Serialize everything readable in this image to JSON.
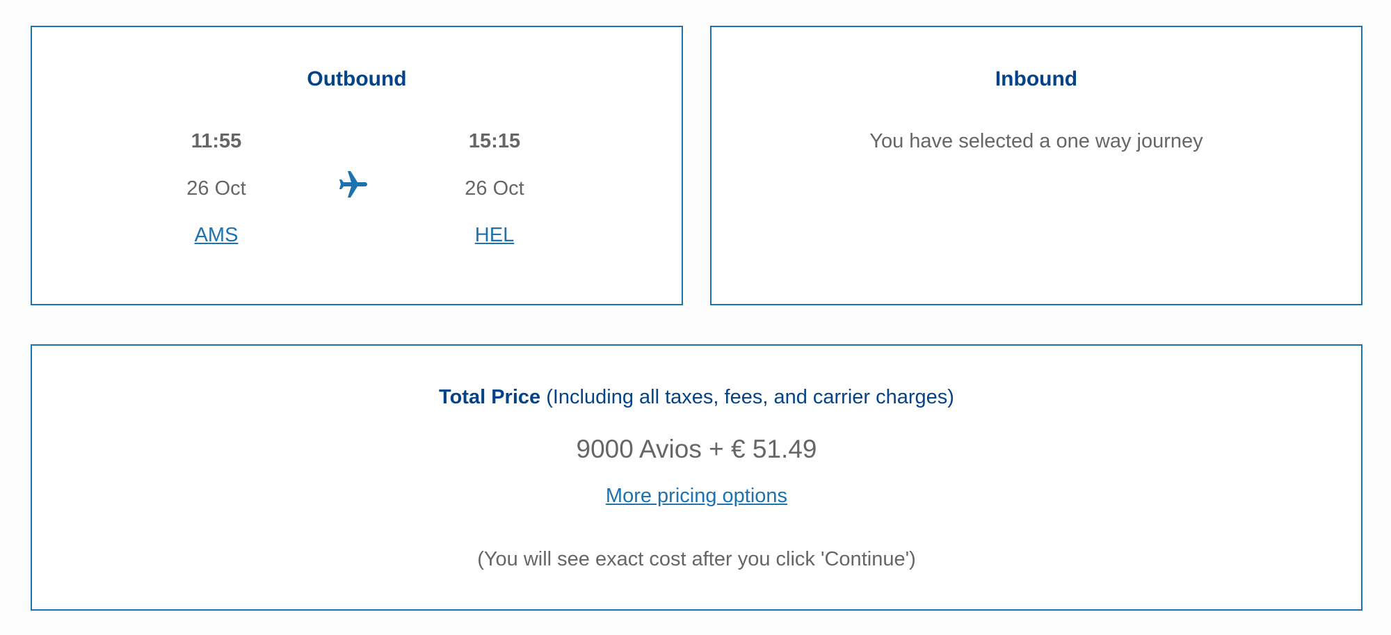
{
  "outbound": {
    "title": "Outbound",
    "departure": {
      "time": "11:55",
      "date": "26 Oct",
      "airport": "AMS"
    },
    "arrival": {
      "time": "15:15",
      "date": "26 Oct",
      "airport": "HEL"
    },
    "icon": "airplane-icon"
  },
  "inbound": {
    "title": "Inbound",
    "message": "You have selected a one way journey"
  },
  "price": {
    "label": "Total Price",
    "qualifier": "(Including all taxes, fees, and carrier charges)",
    "value": "9000 Avios + € 51.49",
    "more_options": "More pricing options",
    "note": "(You will see exact cost after you click 'Continue')"
  },
  "colors": {
    "border": "#1d72b0",
    "heading": "#054389",
    "link": "#1d72b0",
    "text": "#666666"
  }
}
